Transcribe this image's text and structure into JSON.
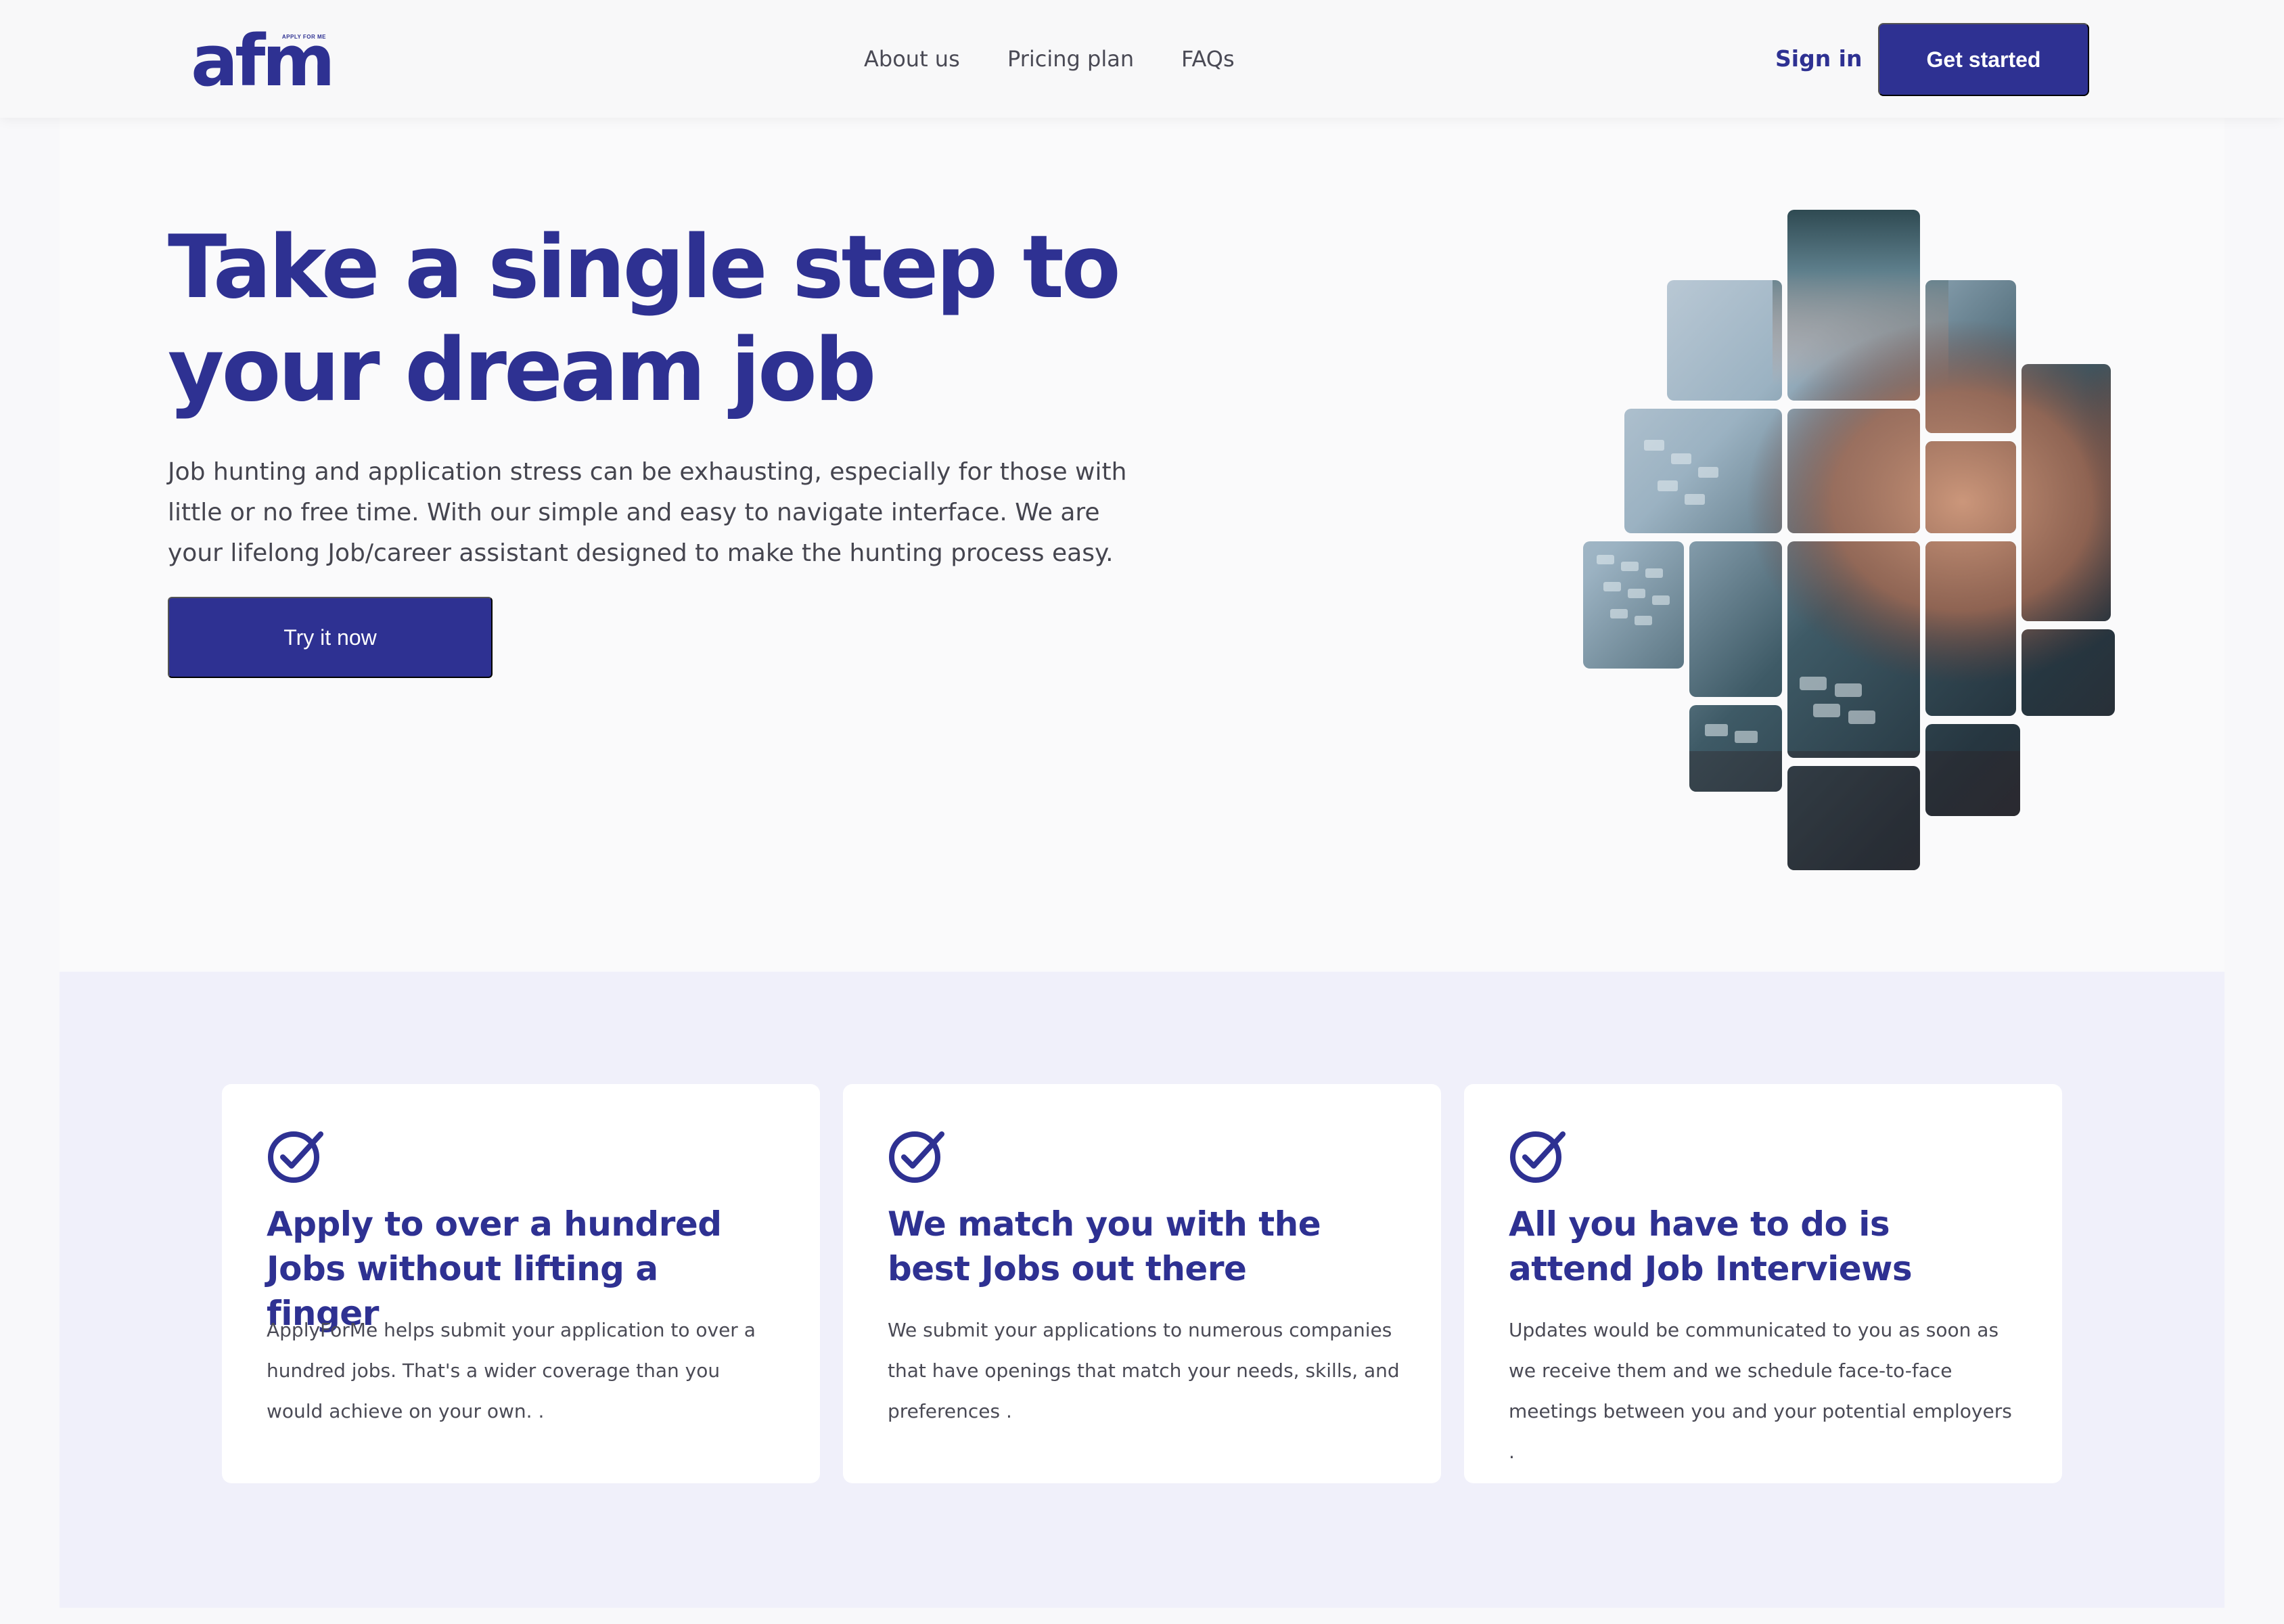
{
  "header": {
    "logo": {
      "tagline": "APPLY FOR ME",
      "wordmark": "afm"
    },
    "nav": [
      {
        "label": "About us"
      },
      {
        "label": "Pricing plan"
      },
      {
        "label": "FAQs"
      }
    ],
    "sign_in": "Sign in",
    "get_started": "Get started"
  },
  "hero": {
    "title_line1": "Take a single step to",
    "title_line2": "your dream job",
    "description": "Job hunting and application stress can be exhausting, especially for those with little or no free time. With our simple and easy to navigate interface. We are your lifelong Job/career assistant designed to make the hunting process easy.",
    "cta": "Try it now",
    "image_description_icon": "typing-on-keyboard-mosaic-image"
  },
  "features": [
    {
      "icon": "check-circle-icon",
      "title": "Apply to over a hundred Jobs without lifting a finger",
      "text": "ApplyForMe helps submit your application to over a hundred jobs. That's a wider coverage than you would achieve on your own. ."
    },
    {
      "icon": "check-circle-icon",
      "title": "We match you with the best Jobs out there",
      "text": "We submit your applications to numerous companies that have openings that match your needs, skills, and preferences ."
    },
    {
      "icon": "check-circle-icon",
      "title": "All you have to do is attend Job Interviews",
      "text": "Updates would be communicated to you as soon as we receive them and we schedule face-to-face meetings between you and your potential employers ."
    }
  ],
  "colors": {
    "brand": "#2e3192",
    "page_background": "#f8f8fa",
    "features_background": "#f0f0fa",
    "card_background": "#ffffff",
    "body_text": "#45454f"
  }
}
